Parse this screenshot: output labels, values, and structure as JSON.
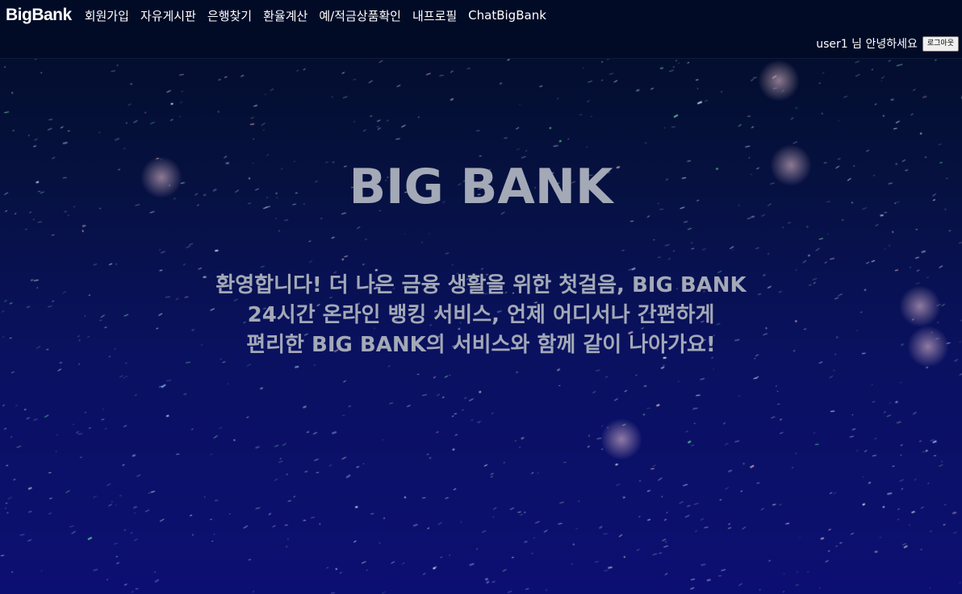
{
  "nav": {
    "brand": "BigBank",
    "links": [
      {
        "label": "회원가입"
      },
      {
        "label": "자유게시판"
      },
      {
        "label": "은행찾기"
      },
      {
        "label": "환율계산"
      },
      {
        "label": "예/적금상품확인"
      },
      {
        "label": "내프로필"
      },
      {
        "label": "ChatBigBank"
      }
    ]
  },
  "user": {
    "greeting": "user1 님 안녕하세요",
    "logout_label": "로그아웃"
  },
  "hero": {
    "title": "BIG BANK",
    "lines": [
      "환영합니다! 더 나은 금융 생활을 위한 첫걸음, BIG BANK",
      "24시간 온라인 뱅킹 서비스, 언제 어디서나 간편하게",
      "편리한 BIG BANK의 서비스와 함께 같이 나아가요!"
    ]
  },
  "colors": {
    "background_top": "#020c26",
    "background_bottom": "#0c0f72",
    "hero_text": "#a3a9b6",
    "nav_text": "#ffffff"
  }
}
